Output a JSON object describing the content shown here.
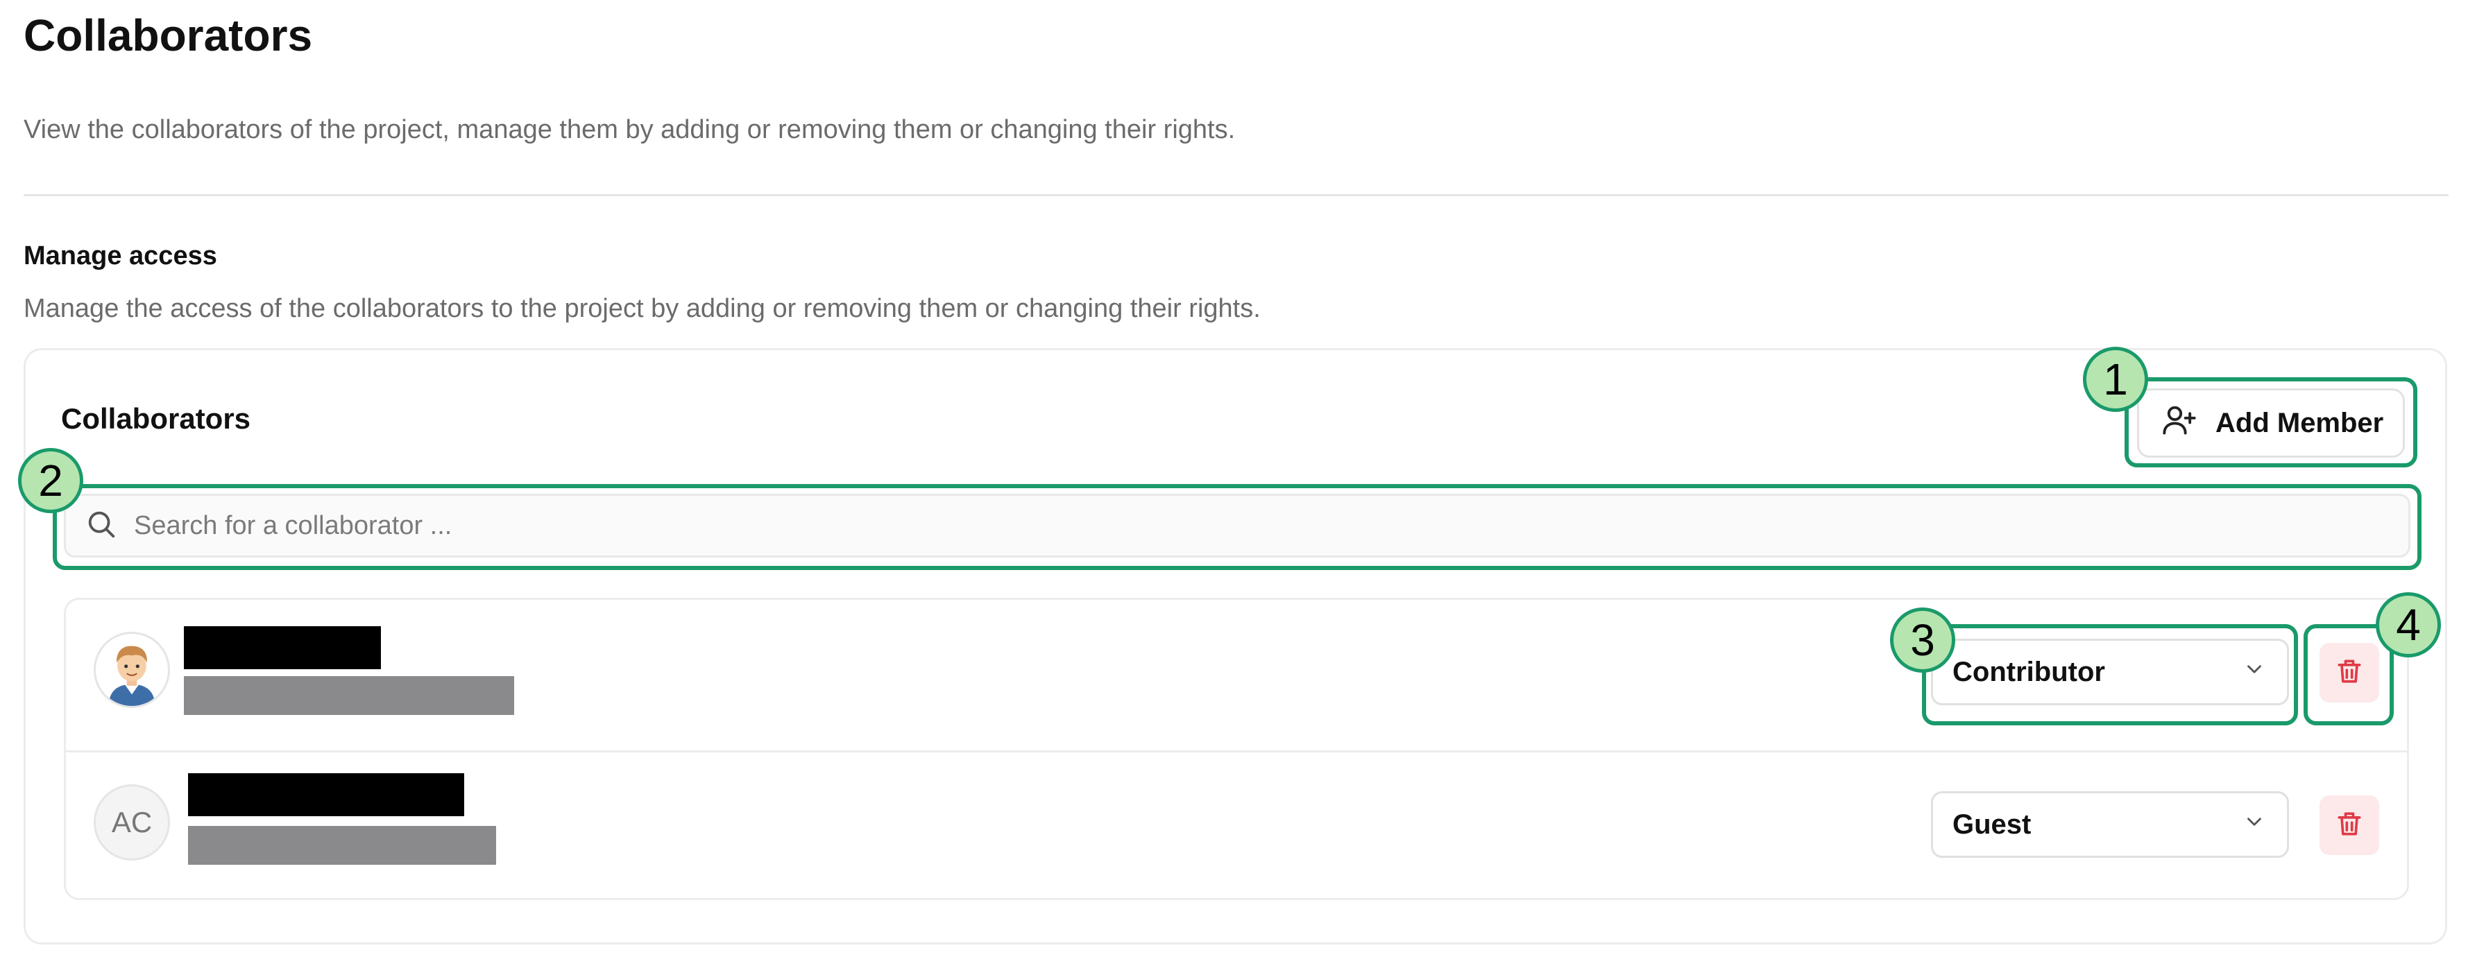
{
  "page": {
    "title": "Collaborators",
    "description": "View the collaborators of the project, manage them by adding or removing them or changing their rights."
  },
  "manage_access": {
    "title": "Manage access",
    "description": "Manage the access of the collaborators to the project by adding or removing them or changing their rights."
  },
  "card": {
    "title": "Collaborators",
    "add_member_label": "Add Member",
    "search_placeholder": "Search for a collaborator ..."
  },
  "collaborators": [
    {
      "avatar": "cartoon-avatar-icon",
      "name": "[redacted]",
      "email": "[redacted]",
      "role": "Contributor"
    },
    {
      "avatar_initials": "AC",
      "name": "[redacted]",
      "email": "[redacted]",
      "role": "Guest"
    }
  ],
  "annotations": [
    "1",
    "2",
    "3",
    "4"
  ],
  "colors": {
    "annotation_outline": "#1a9a6a",
    "annotation_badge": "#b6e5b0",
    "delete_bg": "#fde9ea",
    "delete_icon": "#e03a46",
    "redaction_name": "#000000",
    "redaction_email": "#8a8a8d"
  },
  "icons": {
    "add_member": "add-user-icon",
    "search": "search-icon",
    "dropdown": "chevron-down-icon",
    "delete": "trash-icon"
  }
}
